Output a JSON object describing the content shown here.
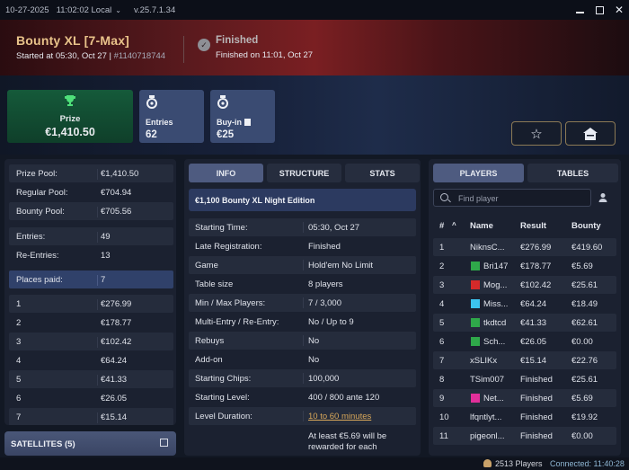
{
  "titlebar": {
    "date": "10-27-2025",
    "time": "11:02:02 Local",
    "version": "v.25.7.1.34"
  },
  "header": {
    "tournament_name": "Bounty XL [7-Max]",
    "started": "Started at 05:30, Oct 27",
    "tournament_id": "#1140718744",
    "status": "Finished",
    "finished_on": "Finished on 11:01, Oct 27"
  },
  "cards": {
    "prize_label": "Prize",
    "prize_value": "€1,410.50",
    "entries_label": "Entries",
    "entries_value": "62",
    "buyin_label": "Buy-in",
    "buyin_value": "€25"
  },
  "summary": [
    {
      "k": "Prize Pool:",
      "v": "€1,410.50"
    },
    {
      "k": "Regular Pool:",
      "v": "€704.94"
    },
    {
      "k": "Bounty Pool:",
      "v": "€705.56"
    },
    {
      "k": "Entries:",
      "v": "49"
    },
    {
      "k": "Re-Entries:",
      "v": "13"
    },
    {
      "k": "Places paid:",
      "v": "7"
    }
  ],
  "payouts": [
    {
      "place": "1",
      "amount": "€276.99"
    },
    {
      "place": "2",
      "amount": "€178.77"
    },
    {
      "place": "3",
      "amount": "€102.42"
    },
    {
      "place": "4",
      "amount": "€64.24"
    },
    {
      "place": "5",
      "amount": "€41.33"
    },
    {
      "place": "6",
      "amount": "€26.05"
    },
    {
      "place": "7",
      "amount": "€15.14"
    }
  ],
  "satellites": {
    "label": "SATELLITES (5)"
  },
  "mid_tabs": [
    "INFO",
    "STRUCTURE",
    "STATS"
  ],
  "edition": "€1,100 Bounty XL Night Edition",
  "info": [
    {
      "k": "Starting Time:",
      "v": "05:30, Oct 27"
    },
    {
      "k": "Late Registration:",
      "v": "Finished"
    },
    {
      "k": "Game",
      "v": "Hold'em No Limit"
    },
    {
      "k": "Table size",
      "v": "8 players"
    },
    {
      "k": "Min / Max Players:",
      "v": "7 / 3,000"
    },
    {
      "k": "Multi-Entry / Re-Entry:",
      "v": "No / Up to 9"
    },
    {
      "k": "Rebuys",
      "v": "No"
    },
    {
      "k": "Add-on",
      "v": "No"
    },
    {
      "k": "Starting Chips:",
      "v": "100,000"
    },
    {
      "k": "Starting Level:",
      "v": "400 / 800 ante 120"
    },
    {
      "k": "Level Duration:",
      "v": "10 to 60 minutes"
    }
  ],
  "note": "At least €5.69 will be rewarded for each",
  "right_tabs": [
    "PLAYERS",
    "TABLES"
  ],
  "search": {
    "placeholder": "Find player"
  },
  "table_headers": {
    "rank": "#",
    "sort": "^",
    "name": "Name",
    "result": "Result",
    "bounty": "Bounty"
  },
  "players": [
    {
      "rank": "1",
      "name": "NiknsC...",
      "flag": "",
      "result": "€276.99",
      "bounty": "€419.60"
    },
    {
      "rank": "2",
      "name": "Bri147",
      "flag": "#2fa84a",
      "result": "€178.77",
      "bounty": "€5.69"
    },
    {
      "rank": "3",
      "name": "Mog...",
      "flag": "#d42a2a",
      "result": "€102.42",
      "bounty": "€25.61"
    },
    {
      "rank": "4",
      "name": "Miss...",
      "flag": "#3cc4ef",
      "result": "€64.24",
      "bounty": "€18.49"
    },
    {
      "rank": "5",
      "name": "tkdtcd",
      "flag": "#2fa84a",
      "result": "€41.33",
      "bounty": "€62.61"
    },
    {
      "rank": "6",
      "name": "Sch...",
      "flag": "#2fa84a",
      "result": "€26.05",
      "bounty": "€0.00"
    },
    {
      "rank": "7",
      "name": "xSLIKx",
      "flag": "",
      "result": "€15.14",
      "bounty": "€22.76"
    },
    {
      "rank": "8",
      "name": "TSim007",
      "flag": "",
      "result": "Finished",
      "bounty": "€25.61"
    },
    {
      "rank": "9",
      "name": "Net...",
      "flag": "#e22f9a",
      "result": "Finished",
      "bounty": "€5.69"
    },
    {
      "rank": "10",
      "name": "lfqntlyt...",
      "flag": "",
      "result": "Finished",
      "bounty": "€19.92"
    },
    {
      "rank": "11",
      "name": "pigeonl...",
      "flag": "",
      "result": "Finished",
      "bounty": "€0.00"
    }
  ],
  "statusbar": {
    "players": "2513 Players",
    "connected": "Connected: 11:40:28"
  }
}
